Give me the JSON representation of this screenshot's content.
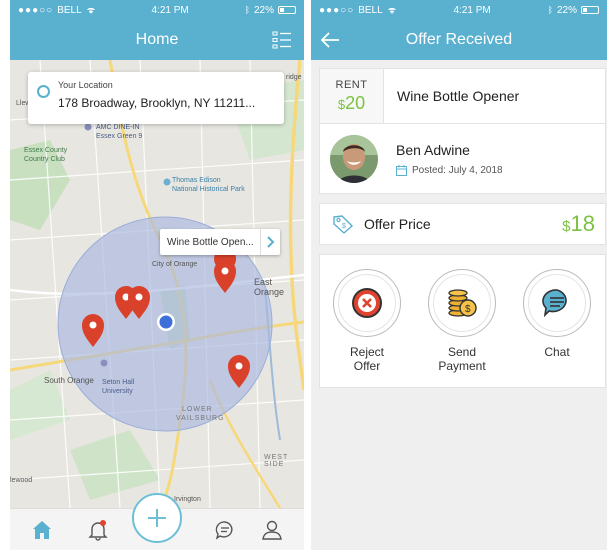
{
  "status_bar": {
    "carrier": "BELL",
    "time": "4:21 PM",
    "battery": "22%"
  },
  "home": {
    "title": "Home",
    "location_card": {
      "label": "Your Location",
      "address": "178 Broadway, Brooklyn, NY 11211..."
    },
    "callout": {
      "text": "Wine Bottle Open..."
    },
    "map_labels": [
      "AMC DINE-IN",
      "Essex Green 9",
      "Essex County",
      "Country Club",
      "Thomas Edison",
      "National Historical Park",
      "City of Orange",
      "East Orange",
      "South Orange",
      "Seton Hall",
      "University",
      "LOWER",
      "VAILSBURG",
      "WEST SIDE",
      "Irvington",
      "Llewellyn",
      "ridge",
      "lewood"
    ],
    "tabs": [
      "home-tab",
      "notifications-tab",
      "add-tab",
      "chat-tab",
      "profile-tab"
    ]
  },
  "offer": {
    "title": "Offer Received",
    "rent_label": "RENT",
    "rent_currency": "$",
    "rent_amount": "20",
    "item_name": "Wine Bottle Opener",
    "user_name": "Ben Adwine",
    "posted": "Posted: July 4, 2018",
    "offer_price_label": "Offer Price",
    "offer_currency": "$",
    "offer_amount": "18",
    "actions": [
      {
        "label_line1": "Reject",
        "label_line2": "Offer",
        "icon": "reject-icon"
      },
      {
        "label_line1": "Send",
        "label_line2": "Payment",
        "icon": "coins-icon"
      },
      {
        "label_line1": "Chat",
        "label_line2": "",
        "icon": "chat-bubble-icon"
      }
    ]
  },
  "colors": {
    "primary": "#5ab0cf",
    "accent_green": "#7cc242",
    "pin_red": "#d9412b",
    "radius_fill": "#a9b9e0"
  }
}
